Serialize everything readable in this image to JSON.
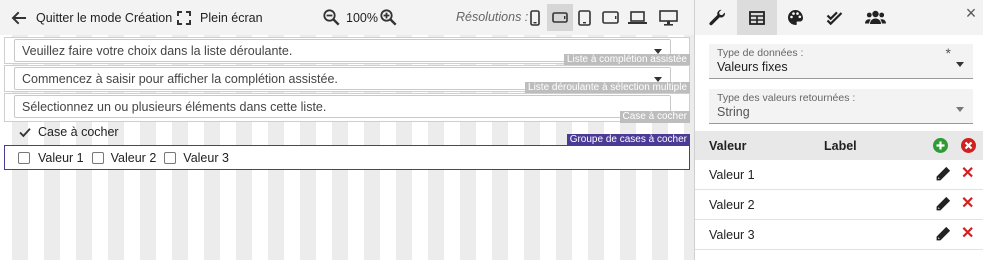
{
  "toolbar": {
    "quit_label": "Quitter le mode Création",
    "fullscreen_label": "Plein écran",
    "zoom": "100%",
    "resolutions_label": "Résolutions :"
  },
  "fields": [
    {
      "text": "Veuillez faire votre choix dans la liste déroulante.",
      "tag": "Liste à complétion assistée"
    },
    {
      "text": "Commencez à saisir pour afficher la complétion assistée.",
      "tag": "Liste déroulante à sélection multiple"
    },
    {
      "text": "Sélectionnez un ou plusieurs éléments dans cette liste.",
      "tag": "Case à cocher"
    }
  ],
  "single_checkbox": {
    "label": "Case à cocher",
    "checked": true,
    "tag": "Groupe de cases à cocher"
  },
  "checkbox_group": [
    "Valeur 1",
    "Valeur 2",
    "Valeur 3"
  ],
  "panel": {
    "close": "×",
    "data_type": {
      "label": "Type de données :",
      "value": "Valeurs fixes",
      "required": "*"
    },
    "return_type": {
      "label": "Type des valeurs retournées :",
      "value": "String"
    },
    "table": {
      "col_value": "Valeur",
      "col_label": "Label",
      "rows": [
        "Valeur 1",
        "Valeur 2",
        "Valeur 3"
      ]
    }
  },
  "colors": {
    "accent": "#4b3b96",
    "add": "#2e9b35",
    "remove": "#d21f1f"
  },
  "icons": [
    "arrow-left-icon",
    "fullscreen-icon",
    "zoom-out-icon",
    "zoom-in-icon",
    "phone-icon",
    "phone-landscape-icon",
    "tablet-icon",
    "tablet-landscape-icon",
    "laptop-icon",
    "desktop-icon",
    "wrench-icon",
    "table-icon",
    "palette-icon",
    "double-check-icon",
    "users-icon",
    "pencil-icon",
    "delete-icon"
  ]
}
